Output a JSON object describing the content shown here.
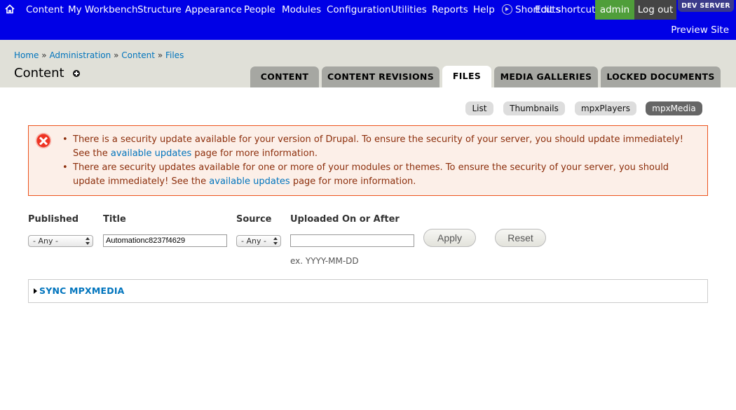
{
  "toolbar": {
    "items": [
      "Content",
      "My Workbench",
      "Structure",
      "Appearance",
      "People",
      "Modules",
      "Configuration",
      "Utilities",
      "Reports",
      "Help"
    ],
    "shortcuts_label": "Shortcuts",
    "edit_shortcuts_label": "Edit shortcuts",
    "user_label": "admin",
    "logout_label": "Log out",
    "server_badge": "DEV SERVER",
    "preview_site_label": "Preview Site"
  },
  "breadcrumb": [
    "Home",
    "Administration",
    "Content",
    "Files"
  ],
  "breadcrumb_separator": "»",
  "page_title": "Content",
  "primary_tabs": [
    {
      "label": "CONTENT",
      "active": false
    },
    {
      "label": "CONTENT REVISIONS",
      "active": false
    },
    {
      "label": "FILES",
      "active": true
    },
    {
      "label": "MEDIA GALLERIES",
      "active": false
    },
    {
      "label": "LOCKED DOCUMENTS",
      "active": false
    }
  ],
  "secondary_tabs": [
    {
      "label": "List",
      "active": false
    },
    {
      "label": "Thumbnails",
      "active": false
    },
    {
      "label": "mpxPlayers",
      "active": false
    },
    {
      "label": "mpxMedia",
      "active": true
    }
  ],
  "messages": {
    "items": [
      {
        "before": "There is a security update available for your version of Drupal. To ensure the security of your server, you should update immediately! See the ",
        "link": "available updates",
        "after": " page for more information."
      },
      {
        "before": "There are security updates available for one or more of your modules or themes. To ensure the security of your server, you should update immediately! See the ",
        "link": "available updates",
        "after": " page for more information."
      }
    ]
  },
  "filters": {
    "published": {
      "label": "Published",
      "value": "- Any -"
    },
    "title": {
      "label": "Title",
      "value": "Automationc8237f4629"
    },
    "source": {
      "label": "Source",
      "value": "- Any -"
    },
    "uploaded": {
      "label": "Uploaded On or After",
      "value": "",
      "description": "ex. YYYY-MM-DD"
    },
    "apply_label": "Apply",
    "reset_label": "Reset"
  },
  "fieldset": {
    "legend": "SYNC MPXMEDIA"
  }
}
